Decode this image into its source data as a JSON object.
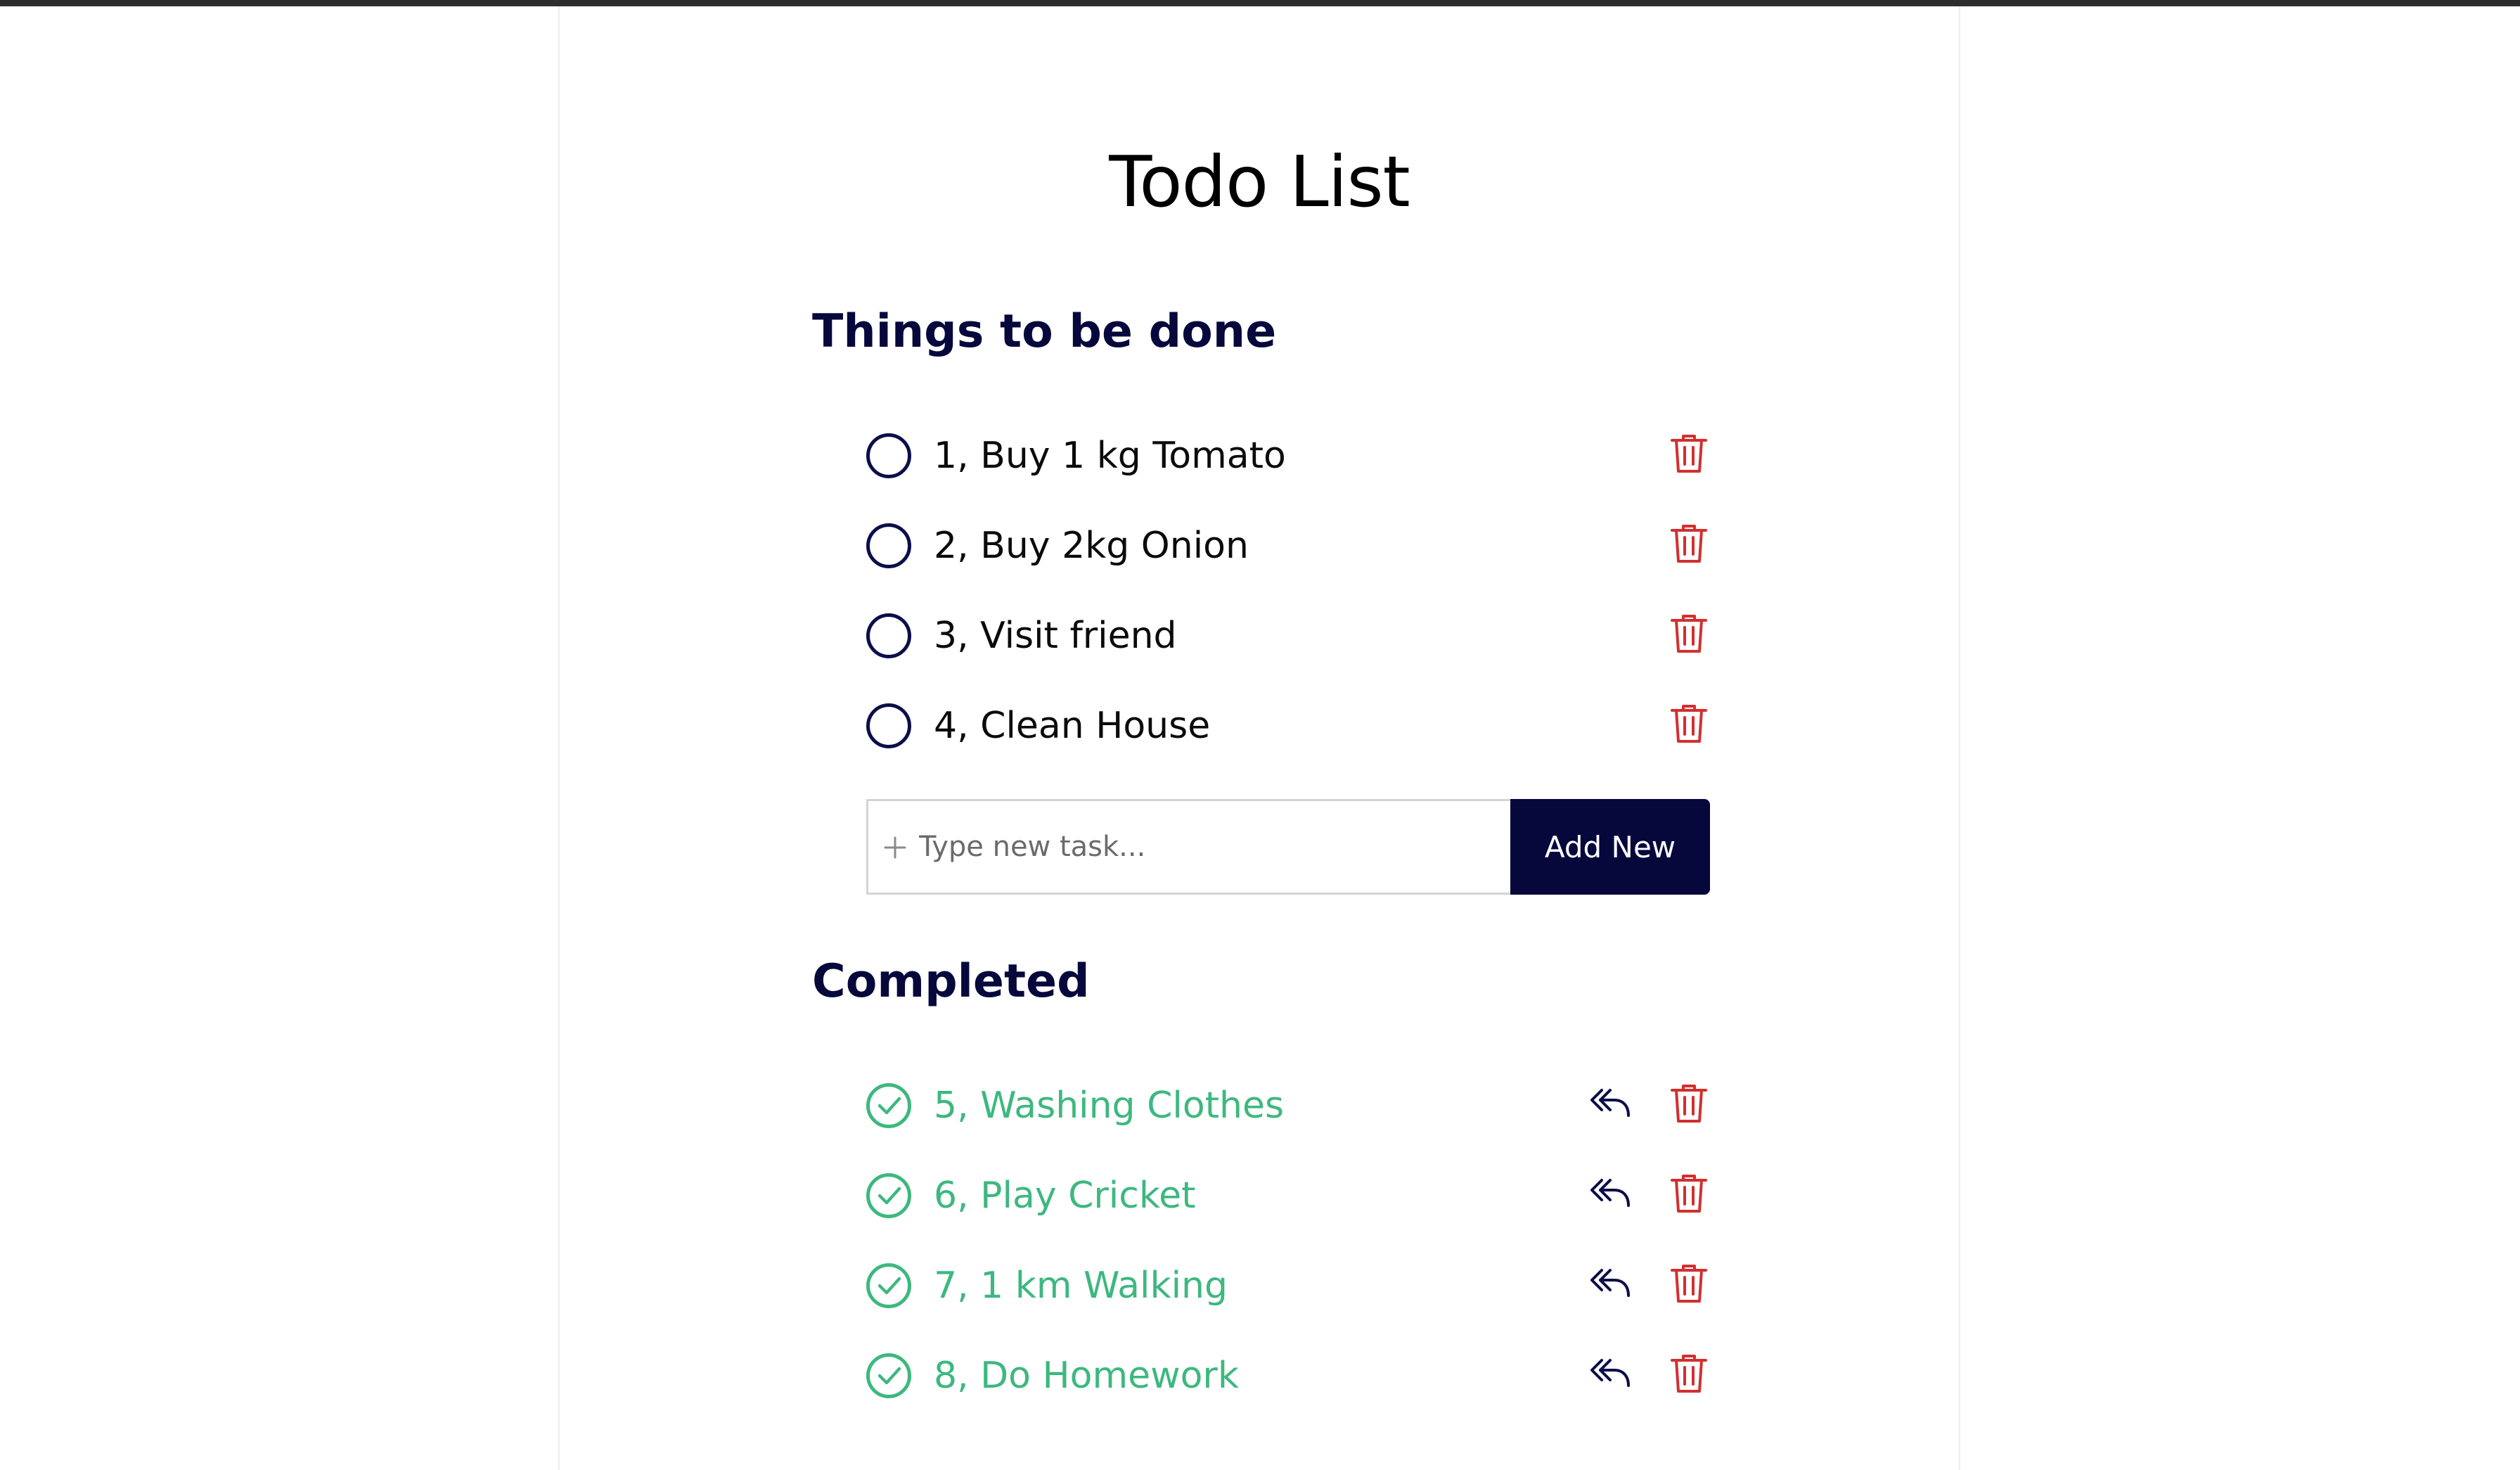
{
  "app": {
    "title": "Todo List"
  },
  "pending": {
    "heading": "Things to be done",
    "items": [
      {
        "label": "1, Buy 1 kg Tomato"
      },
      {
        "label": "2, Buy 2kg Onion"
      },
      {
        "label": "3, Visit friend"
      },
      {
        "label": "4, Clean House"
      }
    ]
  },
  "add_task": {
    "placeholder": "Type new task...",
    "button_label": "Add New"
  },
  "completed": {
    "heading": "Completed",
    "items": [
      {
        "label": "5, Washing Clothes"
      },
      {
        "label": "6, Play Cricket"
      },
      {
        "label": "7, 1 km Walking"
      },
      {
        "label": "8, Do Homework"
      }
    ]
  },
  "icons": {
    "check": "circle-outline-icon",
    "check_done": "check-circle-icon",
    "delete": "trash-icon",
    "undo": "undo-arrow-icon",
    "add": "plus-icon"
  },
  "colors": {
    "top_bar": "#2d2d2d",
    "heading": "#06083c",
    "accent_dark": "#06083c",
    "done_green": "#3db87f",
    "delete_red": "#d32f2f",
    "input_border": "#d4d4d4"
  }
}
